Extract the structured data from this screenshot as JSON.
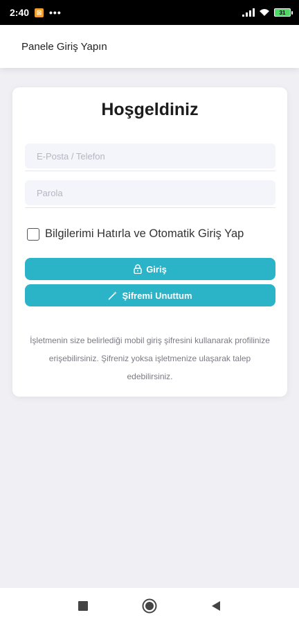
{
  "status_bar": {
    "time": "2:40",
    "dots": "•••",
    "battery": "31"
  },
  "header": {
    "title": "Panele Giriş Yapın"
  },
  "card": {
    "title": "Hoşgeldiniz",
    "email_placeholder": "E-Posta / Telefon",
    "password_placeholder": "Parola",
    "remember_label": "Bilgilerimi Hatırla ve Otomatik Giriş Yap",
    "login_label": "Giriş",
    "forgot_label": "Şifremi Unuttum",
    "info_text": "İşletmenin size belirlediği mobil giriş şifresini kullanarak profilinize erişebilirsiniz. Şifreniz yoksa işletmenize ulaşarak talep edebilirsiniz."
  },
  "colors": {
    "accent": "#2bb3c7",
    "background": "#efeff4"
  },
  "icons": {
    "login": "lock-icon",
    "forgot": "magic-wand-icon",
    "nav_recent": "square-icon",
    "nav_home": "circle-icon",
    "nav_back": "triangle-back-icon"
  }
}
